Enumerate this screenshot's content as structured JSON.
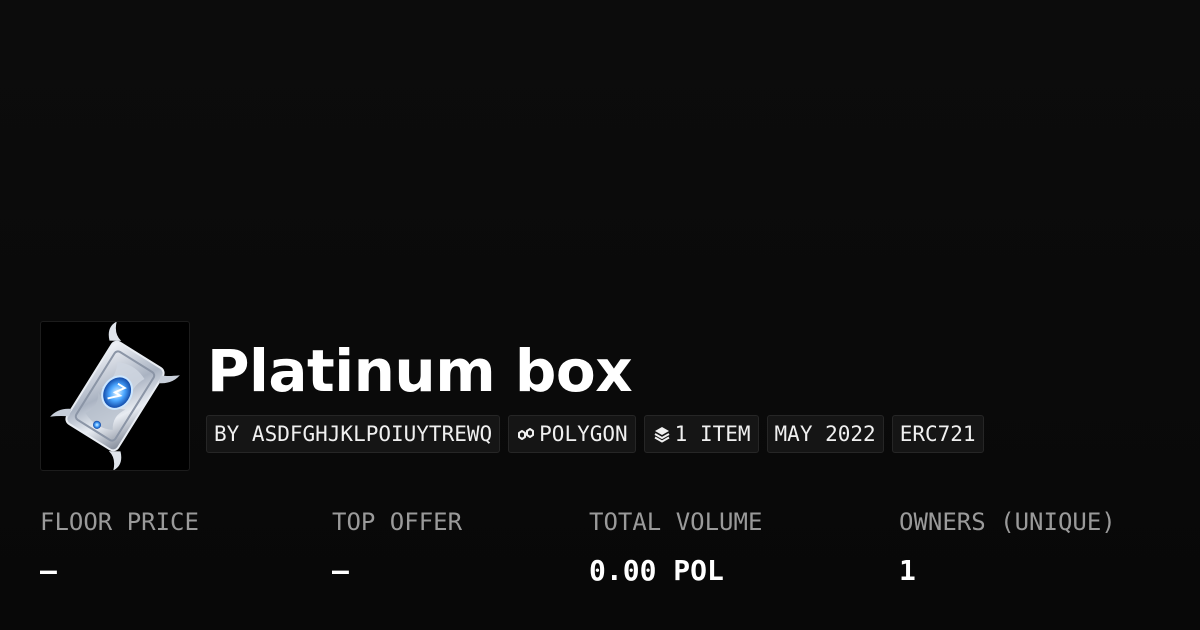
{
  "collection": {
    "title": "Platinum box",
    "image_alt": "platinum card artwork"
  },
  "badges": {
    "creator": "BY ASDFGHJKLPOIUYTREWQ",
    "chain": "POLYGON",
    "chain_icon": "polygon-icon",
    "items": "1 ITEM",
    "items_icon": "layers-icon",
    "date": "MAY 2022",
    "standard": "ERC721"
  },
  "stats": {
    "floor_price": {
      "label": "FLOOR PRICE",
      "value": "–"
    },
    "top_offer": {
      "label": "TOP OFFER",
      "value": "–"
    },
    "total_volume": {
      "label": "TOTAL VOLUME",
      "value": "0.00 POL"
    },
    "owners": {
      "label": "OWNERS (UNIQUE)",
      "value": "1"
    }
  },
  "colors": {
    "background": "#0a0a0a",
    "badge_bg": "#151515",
    "label": "#9a9a9a",
    "text": "#ffffff"
  }
}
